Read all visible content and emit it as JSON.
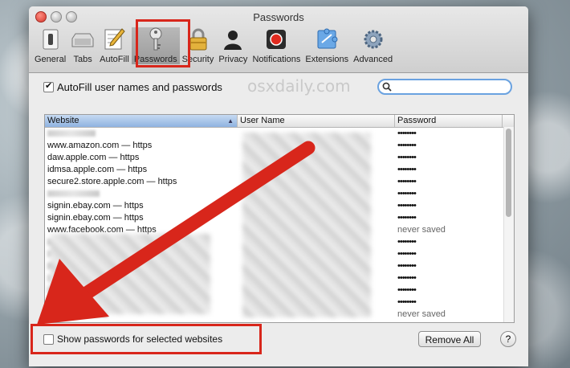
{
  "window": {
    "title": "Passwords"
  },
  "toolbar": [
    {
      "label": "General",
      "icon": "general-switch-icon"
    },
    {
      "label": "Tabs",
      "icon": "tabs-icon"
    },
    {
      "label": "AutoFill",
      "icon": "autofill-pencil-icon"
    },
    {
      "label": "Passwords",
      "icon": "key-icon",
      "active": true
    },
    {
      "label": "Security",
      "icon": "lock-icon"
    },
    {
      "label": "Privacy",
      "icon": "silhouette-icon"
    },
    {
      "label": "Notifications",
      "icon": "notification-icon"
    },
    {
      "label": "Extensions",
      "icon": "puzzle-icon"
    },
    {
      "label": "Advanced",
      "icon": "gear-icon"
    }
  ],
  "autofill": {
    "label": "AutoFill user names and passwords",
    "checked": true
  },
  "watermark": "osxdaily.com",
  "search": {
    "value": "",
    "placeholder": ""
  },
  "table": {
    "columns": [
      "Website",
      "User Name",
      "Password"
    ],
    "rows": [
      {
        "website": "",
        "password": "••••••••"
      },
      {
        "website": "www.amazon.com — https",
        "password": "••••••••"
      },
      {
        "website": "daw.apple.com — https",
        "password": "••••••••"
      },
      {
        "website": "idmsa.apple.com — https",
        "password": "••••••••"
      },
      {
        "website": "secure2.store.apple.com — https",
        "password": "••••••••"
      },
      {
        "website": "",
        "password": "••••••••"
      },
      {
        "website": "signin.ebay.com — https",
        "password": "••••••••"
      },
      {
        "website": "signin.ebay.com — https",
        "password": "••••••••"
      },
      {
        "website": "www.facebook.com — https",
        "password": "never saved"
      },
      {
        "website": "",
        "password": "••••••••"
      },
      {
        "website": "",
        "password": "••••••••"
      },
      {
        "website": "",
        "password": "••••••••"
      },
      {
        "website": "",
        "password": "••••••••"
      },
      {
        "website": "",
        "password": "••••••••"
      },
      {
        "website": "",
        "password": "••••••••"
      },
      {
        "website": "",
        "password": "never saved"
      },
      {
        "website": "",
        "password": "••••••••"
      }
    ]
  },
  "show_passwords": {
    "label": "Show passwords for selected websites",
    "checked": false
  },
  "remove_all_label": "Remove All",
  "help_label": "?",
  "accent": {
    "highlight": "#d8261b",
    "focus": "#6aa2e0"
  }
}
